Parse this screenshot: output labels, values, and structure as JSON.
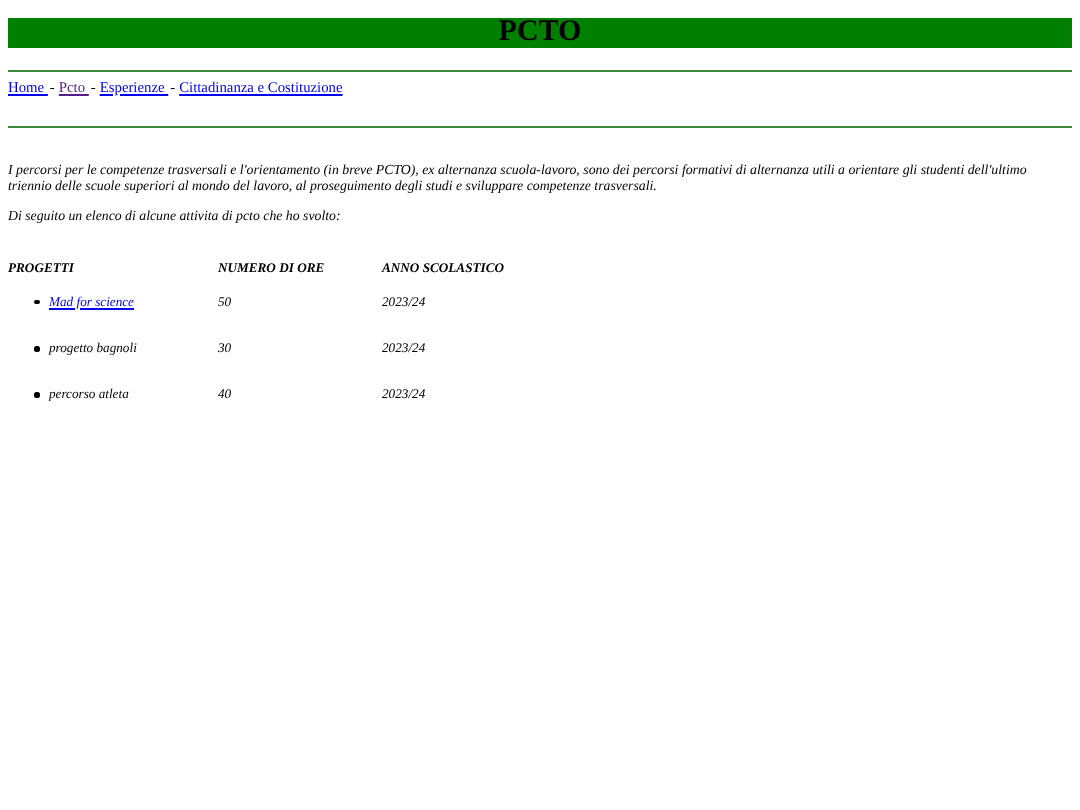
{
  "title": "PCTO",
  "nav": [
    {
      "label": "Home ",
      "visited": false
    },
    {
      "label": "Pcto ",
      "visited": true
    },
    {
      "label": "Esperienze ",
      "visited": false
    },
    {
      "label": "Cittadinanza e Costituzione",
      "visited": false
    }
  ],
  "nav_separator": "-",
  "intro": "I percorsi per le competenze trasversali e l'orientamento (in breve PCTO), ex alternanza scuola-lavoro, sono dei percorsi formativi di alternanza utili a orientare gli studenti dell'ultimo triennio delle scuole superiori al mondo del lavoro, al proseguimento degli studi e sviluppare competenze trasversali.",
  "list_intro": "Di seguito un elenco di alcune attivita di pcto che ho svolto:",
  "table": {
    "columns": [
      "PROGETTI",
      "NUMERO DI ORE",
      "ANNO SCOLASTICO"
    ],
    "rows": [
      {
        "kind": "link",
        "project": "Mad for science",
        "hours": "50",
        "year": "2023/24"
      },
      {
        "kind": "text",
        "project": "progetto bagnoli",
        "hours": "30",
        "year": "2023/24"
      },
      {
        "kind": "text",
        "project": "percorso atleta",
        "hours": "40",
        "year": "2023/24"
      }
    ]
  }
}
